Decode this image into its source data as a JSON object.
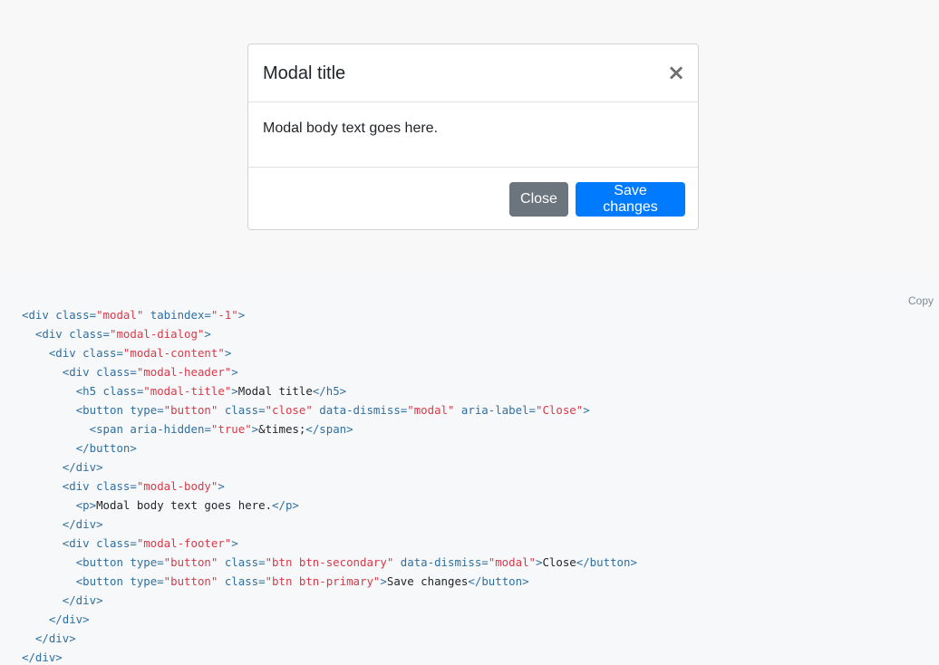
{
  "modal": {
    "title": "Modal title",
    "close_glyph": "×",
    "body_text": "Modal body text goes here.",
    "buttons": {
      "close_label": "Close",
      "save_label": "Save changes"
    }
  },
  "code": {
    "copy_label": "Copy",
    "lines": [
      [
        [
          "tag",
          "<div"
        ],
        [
          "attr",
          " class="
        ],
        [
          "val",
          "\"modal\""
        ],
        [
          "attr",
          " tabindex="
        ],
        [
          "val",
          "\"-1\""
        ],
        [
          "tag",
          ">"
        ]
      ],
      [
        [
          "text",
          "  "
        ],
        [
          "tag",
          "<div"
        ],
        [
          "attr",
          " class="
        ],
        [
          "val",
          "\"modal-dialog\""
        ],
        [
          "tag",
          ">"
        ]
      ],
      [
        [
          "text",
          "    "
        ],
        [
          "tag",
          "<div"
        ],
        [
          "attr",
          " class="
        ],
        [
          "val",
          "\"modal-content\""
        ],
        [
          "tag",
          ">"
        ]
      ],
      [
        [
          "text",
          "      "
        ],
        [
          "tag",
          "<div"
        ],
        [
          "attr",
          " class="
        ],
        [
          "val",
          "\"modal-header\""
        ],
        [
          "tag",
          ">"
        ]
      ],
      [
        [
          "text",
          "        "
        ],
        [
          "tag",
          "<h5"
        ],
        [
          "attr",
          " class="
        ],
        [
          "val",
          "\"modal-title\""
        ],
        [
          "tag",
          ">"
        ],
        [
          "text",
          "Modal title"
        ],
        [
          "tag",
          "</h5>"
        ]
      ],
      [
        [
          "text",
          "        "
        ],
        [
          "tag",
          "<button"
        ],
        [
          "attr",
          " type="
        ],
        [
          "val",
          "\"button\""
        ],
        [
          "attr",
          " class="
        ],
        [
          "val",
          "\"close\""
        ],
        [
          "attr",
          " data-dismiss="
        ],
        [
          "val",
          "\"modal\""
        ],
        [
          "attr",
          " aria-label="
        ],
        [
          "val",
          "\"Close\""
        ],
        [
          "tag",
          ">"
        ]
      ],
      [
        [
          "text",
          "          "
        ],
        [
          "tag",
          "<span"
        ],
        [
          "attr",
          " aria-hidden="
        ],
        [
          "val",
          "\"true\""
        ],
        [
          "tag",
          ">"
        ],
        [
          "text",
          "&times;"
        ],
        [
          "tag",
          "</span>"
        ]
      ],
      [
        [
          "text",
          "        "
        ],
        [
          "tag",
          "</button>"
        ]
      ],
      [
        [
          "text",
          "      "
        ],
        [
          "tag",
          "</div>"
        ]
      ],
      [
        [
          "text",
          "      "
        ],
        [
          "tag",
          "<div"
        ],
        [
          "attr",
          " class="
        ],
        [
          "val",
          "\"modal-body\""
        ],
        [
          "tag",
          ">"
        ]
      ],
      [
        [
          "text",
          "        "
        ],
        [
          "tag",
          "<p>"
        ],
        [
          "text",
          "Modal body text goes here."
        ],
        [
          "tag",
          "</p>"
        ]
      ],
      [
        [
          "text",
          "      "
        ],
        [
          "tag",
          "</div>"
        ]
      ],
      [
        [
          "text",
          "      "
        ],
        [
          "tag",
          "<div"
        ],
        [
          "attr",
          " class="
        ],
        [
          "val",
          "\"modal-footer\""
        ],
        [
          "tag",
          ">"
        ]
      ],
      [
        [
          "text",
          "        "
        ],
        [
          "tag",
          "<button"
        ],
        [
          "attr",
          " type="
        ],
        [
          "val",
          "\"button\""
        ],
        [
          "attr",
          " class="
        ],
        [
          "val",
          "\"btn btn-secondary\""
        ],
        [
          "attr",
          " data-dismiss="
        ],
        [
          "val",
          "\"modal\""
        ],
        [
          "tag",
          ">"
        ],
        [
          "text",
          "Close"
        ],
        [
          "tag",
          "</button>"
        ]
      ],
      [
        [
          "text",
          "        "
        ],
        [
          "tag",
          "<button"
        ],
        [
          "attr",
          " type="
        ],
        [
          "val",
          "\"button\""
        ],
        [
          "attr",
          " class="
        ],
        [
          "val",
          "\"btn btn-primary\""
        ],
        [
          "tag",
          ">"
        ],
        [
          "text",
          "Save changes"
        ],
        [
          "tag",
          "</button>"
        ]
      ],
      [
        [
          "text",
          "      "
        ],
        [
          "tag",
          "</div>"
        ]
      ],
      [
        [
          "text",
          "    "
        ],
        [
          "tag",
          "</div>"
        ]
      ],
      [
        [
          "text",
          "  "
        ],
        [
          "tag",
          "</div>"
        ]
      ],
      [
        [
          "tag",
          "</div>"
        ]
      ]
    ]
  },
  "colors": {
    "primary": "#007bff",
    "secondary": "#6c757d",
    "code_tag": "#2f6f9f",
    "code_value": "#d73a49"
  }
}
